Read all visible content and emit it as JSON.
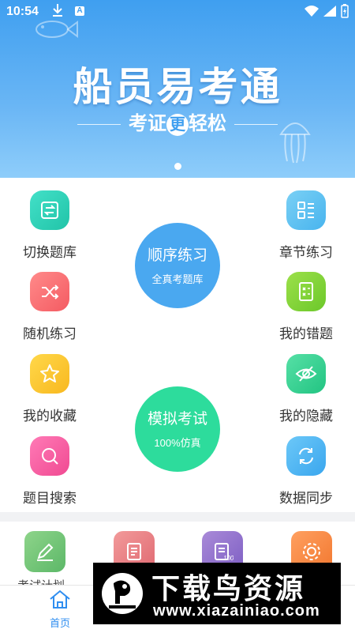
{
  "status_bar": {
    "time": "10:54",
    "notif_badge": "A"
  },
  "banner": {
    "title": "船员易考通",
    "subtitle_left": "考证",
    "subtitle_circle": "更",
    "subtitle_right": "轻松"
  },
  "menu": {
    "switch_bank": "切换题库",
    "chapter_practice": "章节练习",
    "random_practice": "随机练习",
    "my_mistakes": "我的错题",
    "my_favorites": "我的收藏",
    "my_hidden": "我的隐藏",
    "question_search": "题目搜索",
    "data_sync": "数据同步"
  },
  "sequential": {
    "title": "顺序练习",
    "subtitle": "全真考题库"
  },
  "mock_exam": {
    "title": "模拟考试",
    "subtitle": "100%仿真"
  },
  "tools": {
    "first_label": "考试计划"
  },
  "tabbar": {
    "home_label": "首页"
  },
  "watermark": {
    "title": "下载鸟资源",
    "url": "www.xiazainiao.com"
  },
  "colors": {
    "banner_blue": "#4aa6f2",
    "sequential_blue": "#4aa8f0",
    "mock_green": "#2ddc9c",
    "tab_active": "#2f8ef0"
  }
}
